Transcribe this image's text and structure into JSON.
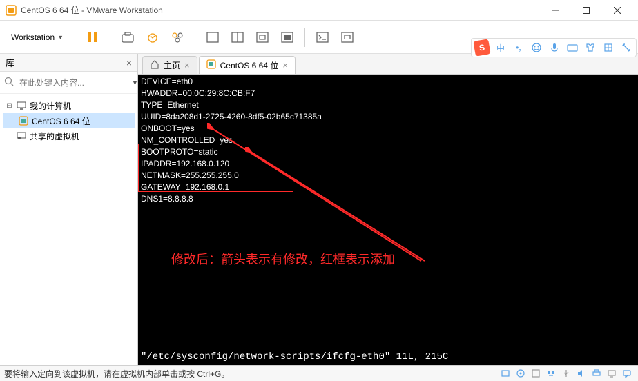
{
  "window": {
    "title": "CentOS 6 64 位 - VMware Workstation"
  },
  "menu": {
    "workstation": "Workstation"
  },
  "sidebar": {
    "title": "库",
    "search_placeholder": "在此处键入内容...",
    "items": [
      {
        "label": "我的计算机"
      },
      {
        "label": "CentOS 6 64 位"
      },
      {
        "label": "共享的虚拟机"
      }
    ]
  },
  "tabs": [
    {
      "label": "主页"
    },
    {
      "label": "CentOS 6 64 位"
    }
  ],
  "terminal": {
    "lines": [
      "DEVICE=eth0",
      "HWADDR=00:0C:29:8C:CB:F7",
      "TYPE=Ethernet",
      "UUID=8da208d1-2725-4260-8df5-02b65c71385a",
      "ONBOOT=yes",
      "NM_CONTROLLED=yes",
      "BOOTPROTO=static",
      "IPADDR=192.168.0.120",
      "NETMASK=255.255.255.0",
      "GATEWAY=192.168.0.1",
      "DNS1=8.8.8.8"
    ],
    "path_line": "\"/etc/sysconfig/network-scripts/ifcfg-eth0\" 11L, 215C",
    "annotation": "修改后：箭头表示有修改，红框表示添加"
  },
  "statusbar": {
    "text": "要将输入定向到该虚拟机，请在虚拟机内部单击或按 Ctrl+G。"
  },
  "ime": {
    "logo": "S",
    "lang": "中"
  }
}
